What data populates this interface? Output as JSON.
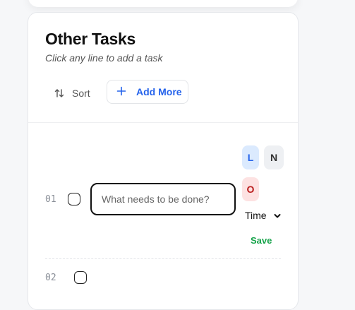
{
  "card": {
    "title": "Other Tasks",
    "subtitle": "Click any line to add a task"
  },
  "toolbar": {
    "sort_label": "Sort",
    "add_label": "Add More"
  },
  "rows": [
    {
      "number": "01",
      "input_placeholder": "What needs to be done?",
      "input_value": "",
      "priorities": [
        "L",
        "N",
        "O"
      ],
      "time_label": "Time",
      "save_label": "Save"
    },
    {
      "number": "02"
    }
  ],
  "colors": {
    "accent": "#2563eb",
    "save": "#16a34a",
    "priority_low_bg": "#dbeafe",
    "priority_normal_bg": "#eef0f3",
    "priority_o_bg": "#fde2e2",
    "priority_o_fg": "#b91c1c"
  },
  "icons": {
    "sort": "sort-arrows-icon",
    "add": "plus-icon",
    "time_dropdown": "chevron-down-icon"
  }
}
